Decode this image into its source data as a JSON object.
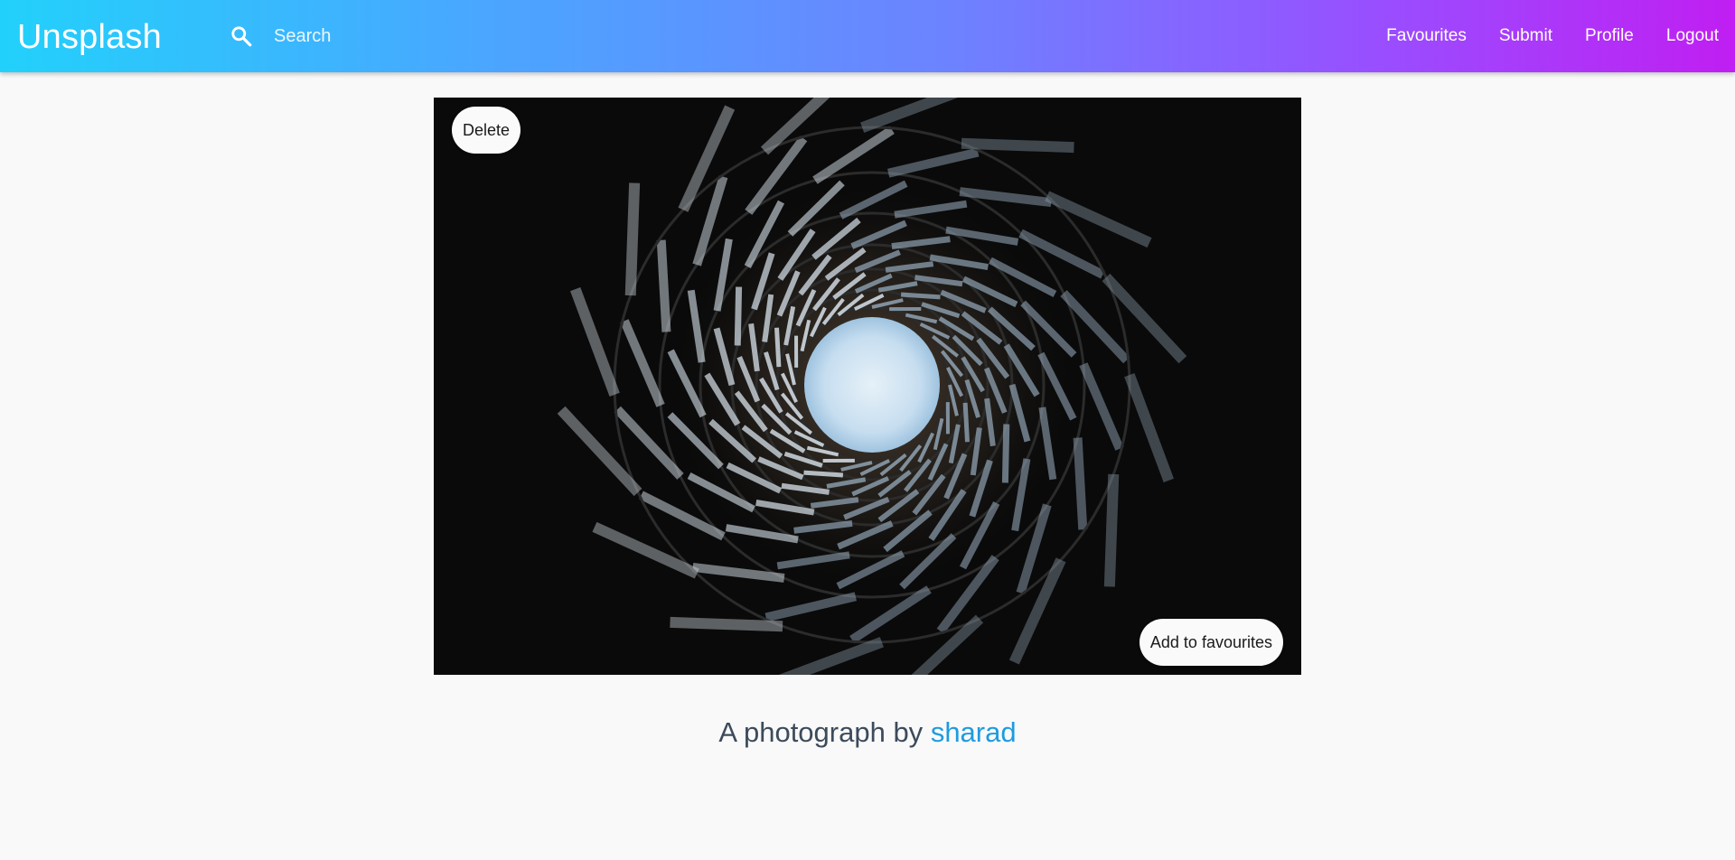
{
  "header": {
    "brand": "Unsplash",
    "search_placeholder": "Search",
    "search_value": "",
    "nav": [
      {
        "label": "Favourites"
      },
      {
        "label": "Submit"
      },
      {
        "label": "Profile"
      },
      {
        "label": "Logout"
      }
    ],
    "gradient_colors": [
      "#22d1fb",
      "#6d82ff",
      "#c01ef2"
    ]
  },
  "photo": {
    "delete_label": "Delete",
    "favourite_label": "Add to favourites"
  },
  "caption": {
    "prefix": "A photograph by",
    "author": "sharad",
    "author_color": "#1e9be0"
  },
  "icons": {
    "search": "search-icon"
  }
}
